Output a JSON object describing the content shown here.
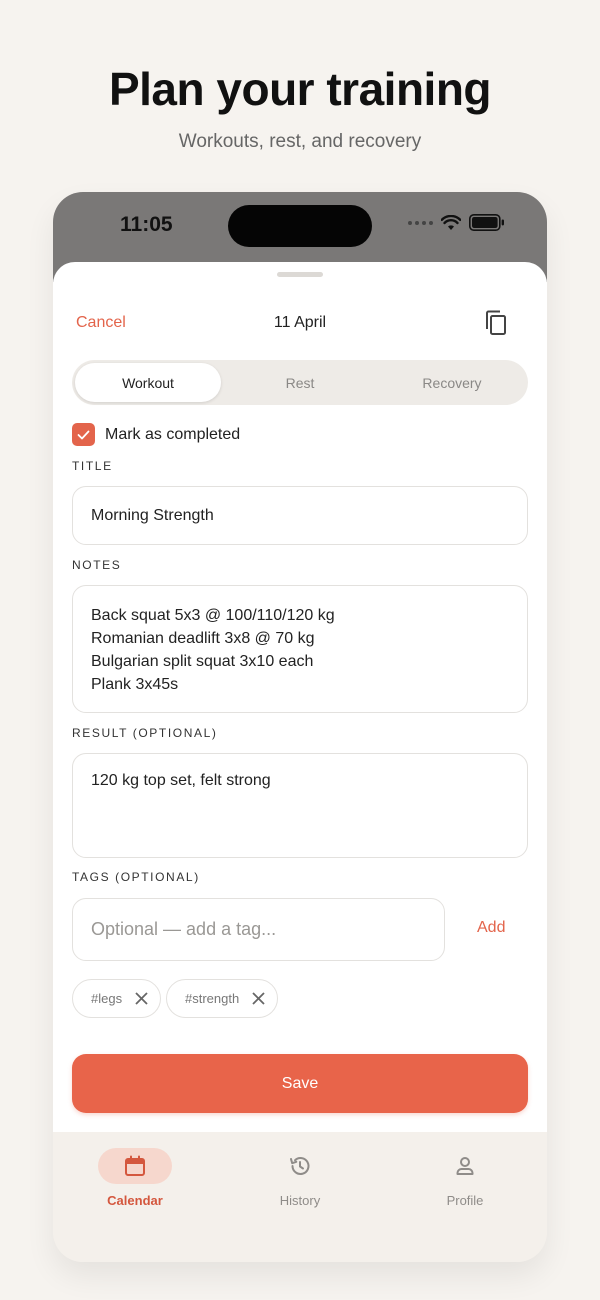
{
  "marketing": {
    "headline": "Plan your training",
    "subheadline": "Workouts, rest, and recovery"
  },
  "status_bar": {
    "time": "11:05"
  },
  "sheet": {
    "cancel_label": "Cancel",
    "date": "11 April",
    "copy_icon": "copy-icon"
  },
  "segments": [
    {
      "label": "Workout",
      "selected": true
    },
    {
      "label": "Rest",
      "selected": false
    },
    {
      "label": "Recovery",
      "selected": false
    }
  ],
  "completed": {
    "label": "Mark as completed",
    "checked": true
  },
  "title_field": {
    "label": "TITLE",
    "value": "Morning Strength"
  },
  "notes_field": {
    "label": "NOTES",
    "lines": [
      "Back squat 5x3 @ 100/110/120 kg",
      "Romanian deadlift 3x8 @ 70 kg",
      "Bulgarian split squat 3x10 each",
      "Plank 3x45s"
    ]
  },
  "result_field": {
    "label": "RESULT (OPTIONAL)",
    "value": "120 kg top set, felt strong"
  },
  "tags": {
    "label": "TAGS (OPTIONAL)",
    "placeholder": "Optional — add a tag...",
    "add_label": "Add",
    "items": [
      "#legs",
      "#strength"
    ]
  },
  "save_label": "Save",
  "tab_bar": {
    "items": [
      {
        "label": "Calendar",
        "icon": "calendar-icon",
        "active": true
      },
      {
        "label": "History",
        "icon": "history-icon",
        "active": false
      },
      {
        "label": "Profile",
        "icon": "profile-icon",
        "active": false
      }
    ]
  },
  "colors": {
    "accent": "#e8644a",
    "background": "#f6f3ef",
    "tab_active_bg": "#f6d7cd"
  }
}
